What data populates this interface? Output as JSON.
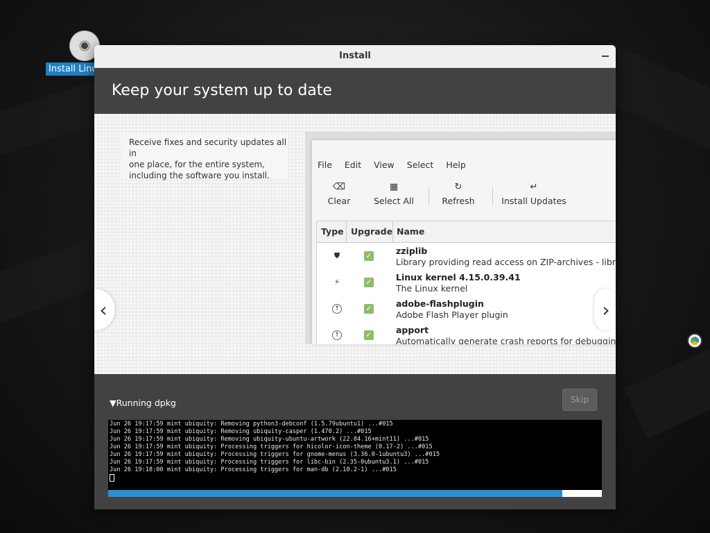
{
  "desktop": {
    "icon_label": "Install Linux Mint",
    "icon_name": "disc-icon"
  },
  "window": {
    "title": "Install",
    "header": "Keep your system up to date"
  },
  "slide": {
    "description_lines": [
      "Receive fixes and security updates all in",
      "one place, for the entire system,",
      "including the software you install."
    ],
    "prev_icon": "chevron-left-icon",
    "next_icon": "chevron-right-icon",
    "menu": [
      "File",
      "Edit",
      "View",
      "Select",
      "Help"
    ],
    "toolbar": [
      {
        "label": "Clear",
        "icon": "clear-icon",
        "glyph": "⌫"
      },
      {
        "label": "Select All",
        "icon": "select-all-icon",
        "glyph": "▦"
      },
      {
        "label": "Refresh",
        "icon": "refresh-icon",
        "glyph": "↻"
      },
      {
        "label": "Install Updates",
        "icon": "install-updates-icon",
        "glyph": "↵"
      }
    ],
    "columns": [
      "Type",
      "Upgrade",
      "Name"
    ],
    "rows": [
      {
        "name": "zziplib",
        "desc": "Library providing read access on ZIP-archives - library",
        "type_icon": "shield-icon",
        "glyph": "⛊"
      },
      {
        "name": "Linux kernel 4.15.0.39.41",
        "desc": "The Linux kernel",
        "type_icon": "kernel-icon",
        "glyph": "⚡"
      },
      {
        "name": "adobe-flashplugin",
        "desc": "Adobe Flash Player plugin",
        "type_icon": "upgrade-icon",
        "glyph": "↑"
      },
      {
        "name": "apport",
        "desc": "Automatically generate crash reports for debugging",
        "type_icon": "upgrade-icon",
        "glyph": "↑"
      }
    ]
  },
  "status": {
    "expander": "Running dpkg",
    "skip": "Skip",
    "progress_percent": 92,
    "log": [
      "Jun 26 19:17:59 mint ubiquity: Removing python3-debconf (1.5.79ubuntu1) ...#015",
      "Jun 26 19:17:59 mint ubiquity: Removing ubiquity-casper (1.470.2) ...#015",
      "Jun 26 19:17:59 mint ubiquity: Removing ubiquity-ubuntu-artwork (22.04.16+mint11) ...#015",
      "Jun 26 19:17:59 mint ubiquity: Processing triggers for hicolor-icon-theme (0.17-2) ...#015",
      "Jun 26 19:17:59 mint ubiquity: Processing triggers for gnome-menus (3.36.0-1ubuntu3) ...#015",
      "Jun 26 19:17:59 mint ubiquity: Processing triggers for libc-bin (2.35-0ubuntu3.1) ...#015",
      "Jun 26 19:18:00 mint ubiquity: Processing triggers for man-db (2.10.2-1) ...#015"
    ]
  },
  "colors": {
    "accent": "#2a8fd1",
    "header_bg": "#424242",
    "check": "#8ebc6b"
  }
}
